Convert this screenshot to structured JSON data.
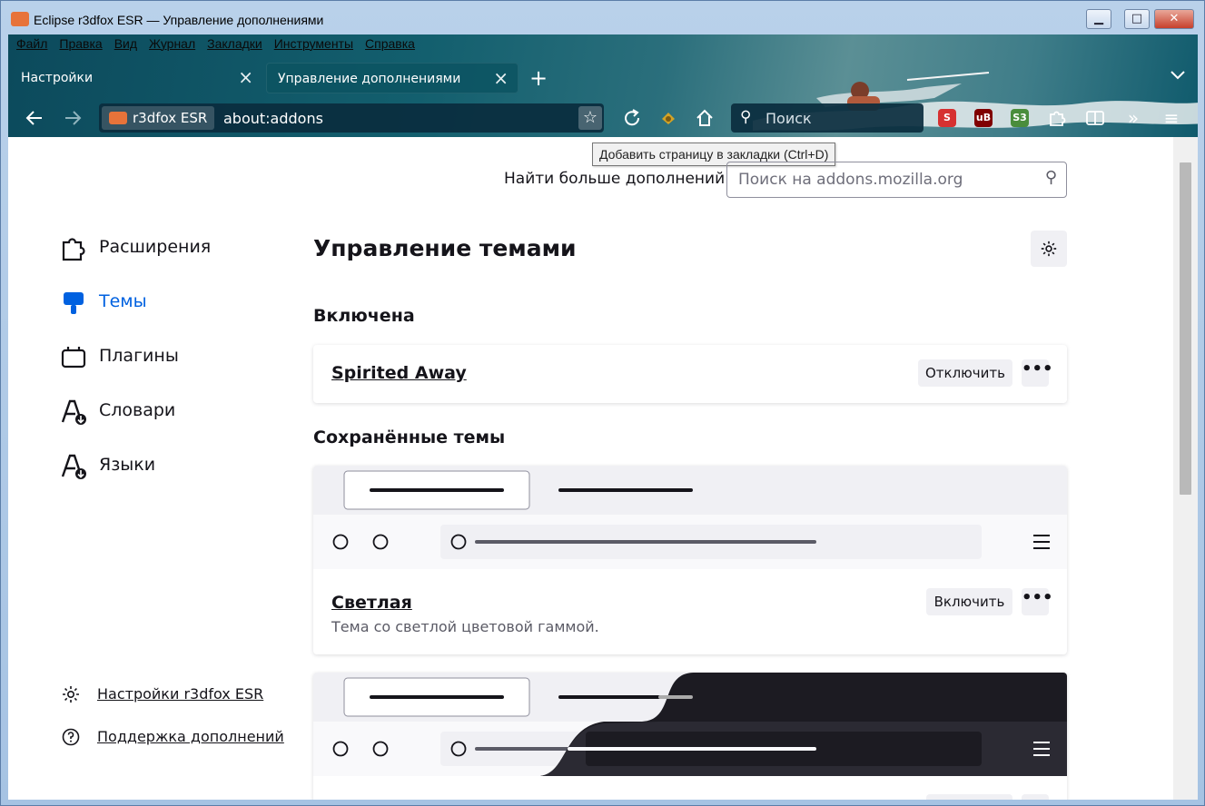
{
  "window": {
    "title": "Eclipse r3dfox ESR — Управление дополнениями",
    "min_label": "▁",
    "max_label": "□",
    "close_label": "✕"
  },
  "menubar": [
    "Файл",
    "Правка",
    "Вид",
    "Журнал",
    "Закладки",
    "Инструменты",
    "Справка"
  ],
  "tabs": [
    {
      "label": "Настройки",
      "active": false
    },
    {
      "label": "Управление дополнениями",
      "active": true
    }
  ],
  "navbar": {
    "identity_label": "r3dfox ESR",
    "url": "about:addons",
    "search_placeholder": "Поиск",
    "bookmark_tooltip": "Добавить страницу в закладки (Ctrl+D)"
  },
  "page": {
    "find_more_label": "Найти больше дополнений",
    "amo_search_placeholder": "Поиск на addons.mozilla.org",
    "heading": "Управление темами",
    "enabled_heading": "Включена",
    "saved_heading": "Сохранённые темы"
  },
  "categories": [
    {
      "label": "Расширения",
      "icon": "puzzle-icon",
      "active": false
    },
    {
      "label": "Темы",
      "icon": "brush-icon",
      "active": true
    },
    {
      "label": "Плагины",
      "icon": "plugin-icon",
      "active": false
    },
    {
      "label": "Словари",
      "icon": "dictionary-icon",
      "active": false
    },
    {
      "label": "Языки",
      "icon": "language-icon",
      "active": false
    }
  ],
  "sidebar_links": [
    {
      "label": "Настройки r3dfox ESR",
      "icon": "gear-icon"
    },
    {
      "label": "Поддержка дополнений",
      "icon": "help-icon"
    }
  ],
  "enabled_theme": {
    "name": "Spirited Away",
    "action_label": "Отключить",
    "more_label": "•••"
  },
  "saved_themes": [
    {
      "name": "Светлая",
      "description": "Тема со светлой цветовой гаммой.",
      "action_label": "Включить",
      "more_label": "•••"
    },
    {
      "name": "",
      "description": "",
      "action_label": "",
      "more_label": ""
    }
  ],
  "colors": {
    "accent": "#0061e0",
    "text": "#15141a",
    "button_bg": "#f0f0f4",
    "chrome_teal": "#135f6e",
    "dark_preview": "#1c1b22"
  }
}
